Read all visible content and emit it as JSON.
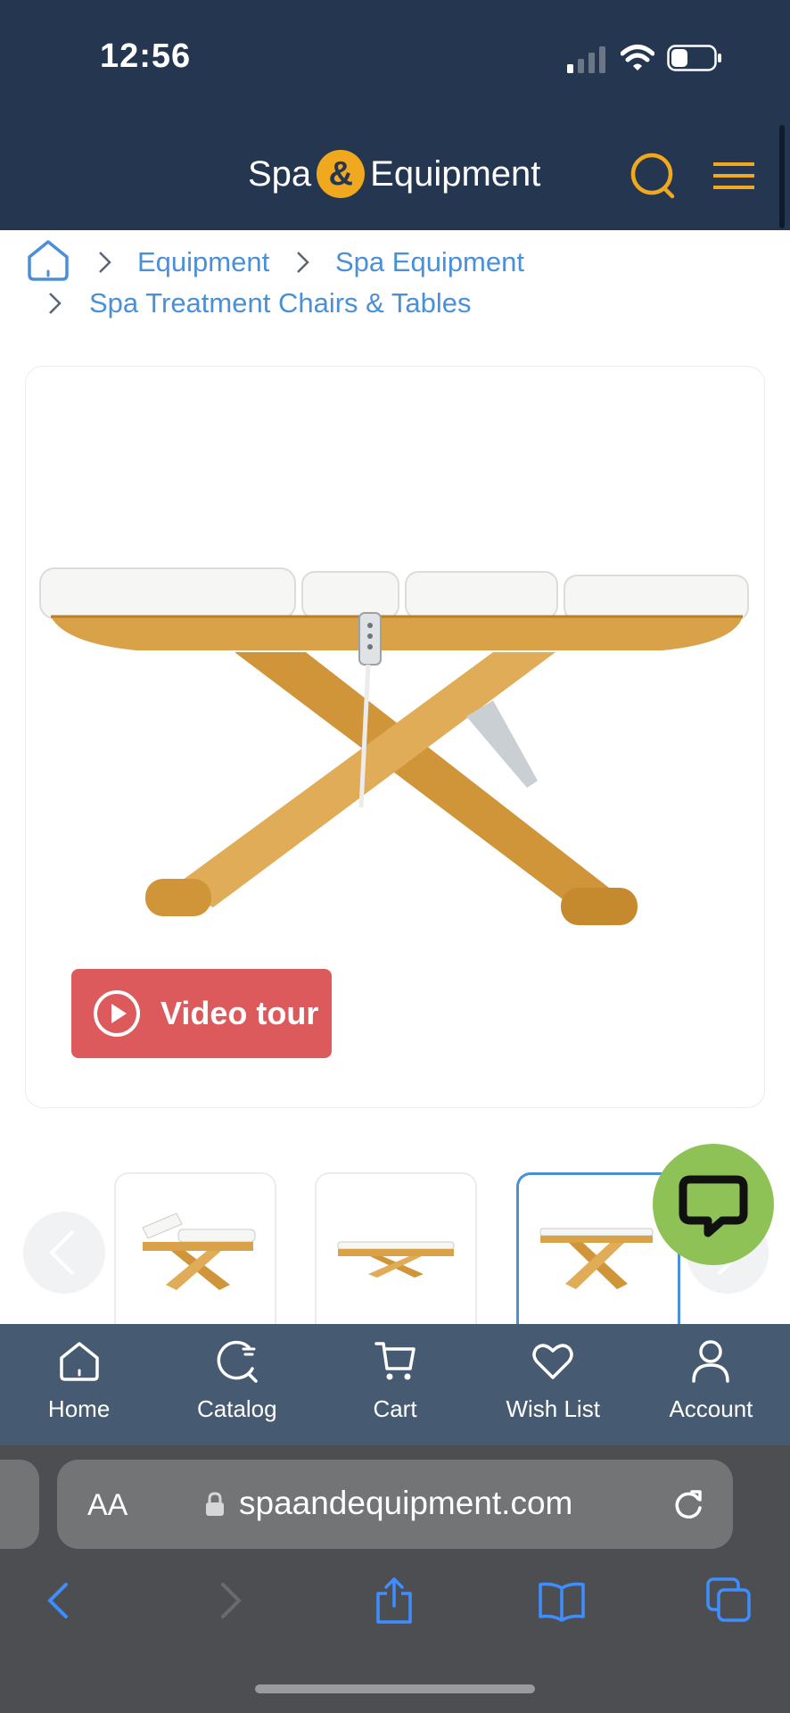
{
  "status_bar": {
    "time": "12:56"
  },
  "header": {
    "logo_left": "Spa",
    "logo_amp": "&",
    "logo_right": "Equipment",
    "search_icon": "search-icon",
    "menu_icon": "hamburger-icon",
    "accent": "#f0a81e",
    "background": "#253750"
  },
  "breadcrumb": {
    "home_icon": "home-icon",
    "items": [
      "Equipment",
      "Spa Equipment",
      "Spa Treatment Chairs & Tables"
    ]
  },
  "product": {
    "video_tour_label": "Video tour",
    "video_tour_color": "#dc5a5c"
  },
  "thumbnails": {
    "count_visible": 3,
    "active_index": 2
  },
  "chat": {
    "icon": "chat-bubble-icon",
    "color": "#8fc256"
  },
  "bottom_nav": {
    "items": [
      {
        "label": "Home",
        "icon": "home-icon"
      },
      {
        "label": "Catalog",
        "icon": "catalog-icon"
      },
      {
        "label": "Cart",
        "icon": "cart-icon"
      },
      {
        "label": "Wish List",
        "icon": "heart-icon"
      },
      {
        "label": "Account",
        "icon": "user-icon"
      }
    ]
  },
  "browser": {
    "text_size_label": "AA",
    "url": "spaandequipment.com"
  }
}
